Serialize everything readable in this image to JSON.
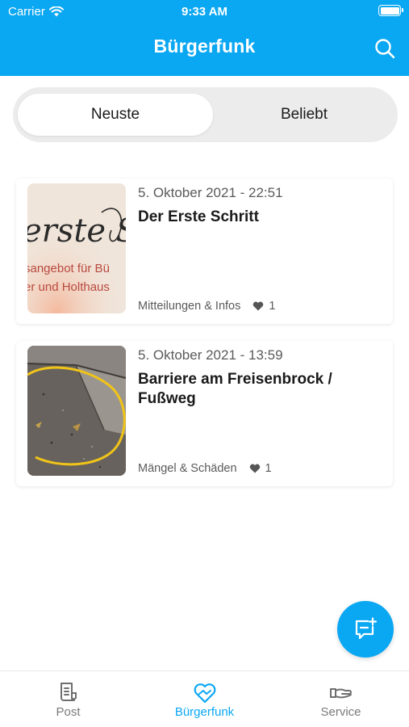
{
  "status_bar": {
    "carrier": "Carrier",
    "time": "9:33 AM"
  },
  "header": {
    "title": "Bürgerfunk",
    "search_icon": "search-icon"
  },
  "segments": {
    "active": "Neuste",
    "inactive": "Beliebt"
  },
  "posts": [
    {
      "date": "5. Oktober 2021 - 22:51",
      "title": "Der Erste Schritt",
      "category": "Mitteilungen & Infos",
      "likes": "1",
      "thumb_text": [
        "erste S",
        "sangebot für Bü",
        "er und Holthaus"
      ]
    },
    {
      "date": "5. Oktober 2021 - 13:59",
      "title": "Barriere am Freisenbrock / Fußweg",
      "category": "Mängel & Schäden",
      "likes": "1"
    }
  ],
  "fab": {
    "icon": "new-post-icon"
  },
  "tabbar": {
    "tabs": [
      {
        "label": "Post",
        "icon": "document-icon"
      },
      {
        "label": "Bürgerfunk",
        "icon": "heart-hands-icon"
      },
      {
        "label": "Service",
        "icon": "hand-icon"
      }
    ],
    "active_index": 1
  },
  "colors": {
    "accent": "#0aa7f2",
    "text_secondary": "#5a5a5a",
    "segment_bg": "#ececec"
  }
}
